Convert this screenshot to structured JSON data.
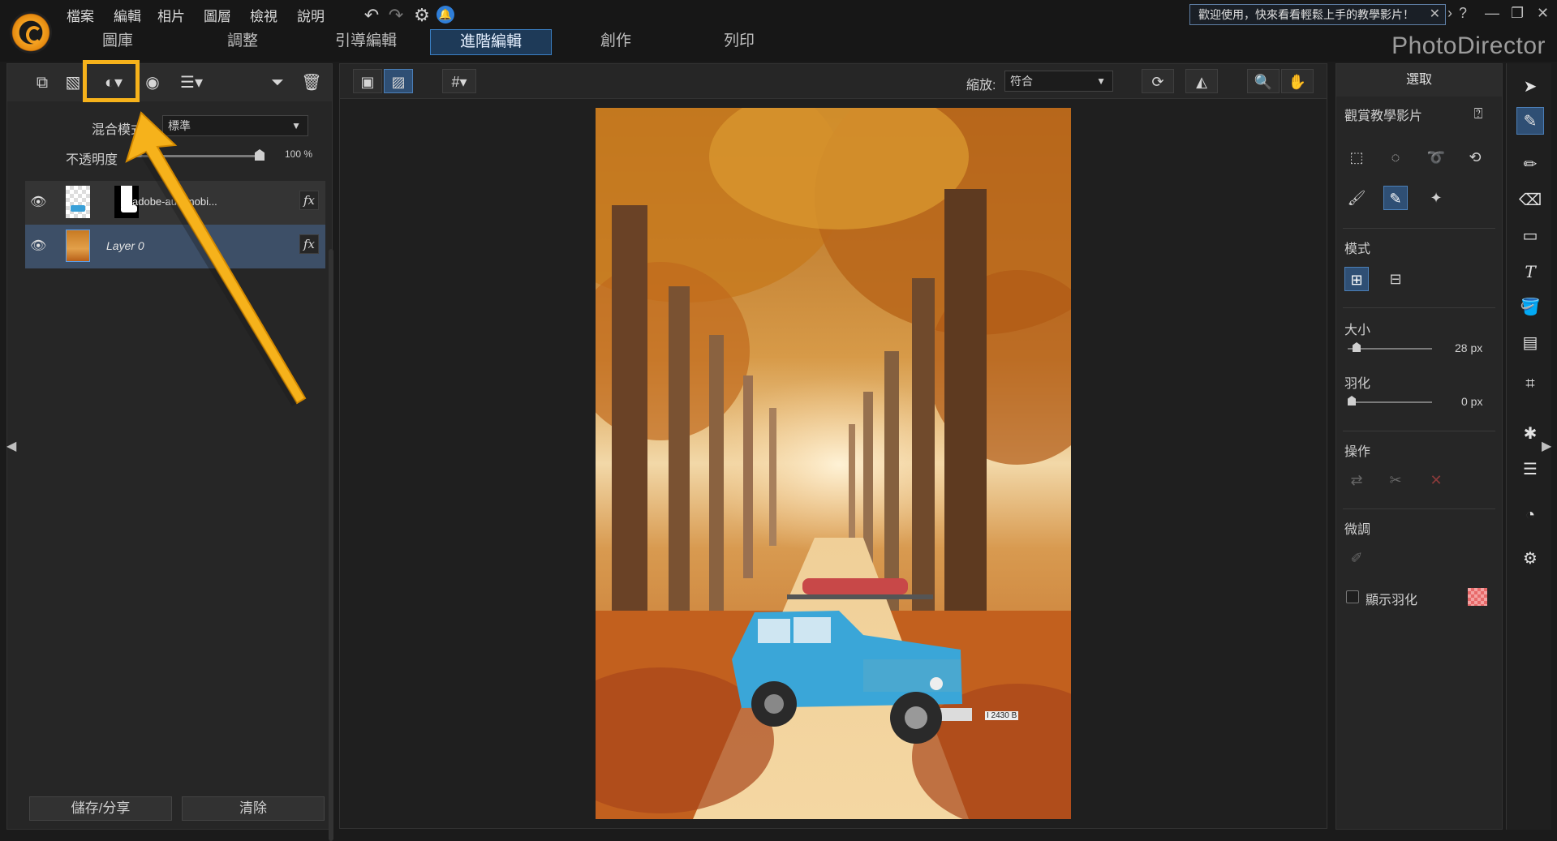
{
  "app": {
    "brand": "PhotoDirector"
  },
  "menu": {
    "items": [
      "檔案",
      "編輯",
      "相片",
      "圖層",
      "檢視",
      "說明"
    ]
  },
  "tabs": [
    "圖庫",
    "調整",
    "引導編輯",
    "進階編輯",
    "創作",
    "列印"
  ],
  "active_tab": "進階編輯",
  "welcome": {
    "text": "歡迎使用，快來看看輕鬆上手的教學影片！"
  },
  "window_controls": {
    "help": "?",
    "minimize": "—",
    "restore": "❐",
    "close": "✕"
  },
  "layers_panel": {
    "blend_label": "混合模式:",
    "blend_value": "標準",
    "opacity_label": "不透明度",
    "opacity_value": "100 %",
    "opacity_fraction": 1.0,
    "layers": [
      {
        "name": "adobe-automobi...",
        "selected": false
      },
      {
        "name": "Layer 0",
        "selected": true
      }
    ],
    "fx_label": "fx",
    "save_share": "儲存/分享",
    "clear": "清除"
  },
  "canvas_toolbar": {
    "zoom_label": "縮放:",
    "zoom_value": "符合"
  },
  "selection_panel": {
    "header": "選取",
    "tutorial": "觀賞教學影片",
    "mode_label": "模式",
    "size_label": "大小",
    "size_value": "28 px",
    "size_fraction": 0.06,
    "feather_label": "羽化",
    "feather_value": "0 px",
    "feather_fraction": 0.0,
    "operation_label": "操作",
    "refine_label": "微調",
    "show_feather_label": "顯示羽化",
    "feather_color": "#e86a6a"
  },
  "colors": {
    "accent": "#3a7fc4",
    "highlight": "#f6b21b"
  },
  "photo": {
    "plate": "I 2430 B"
  }
}
